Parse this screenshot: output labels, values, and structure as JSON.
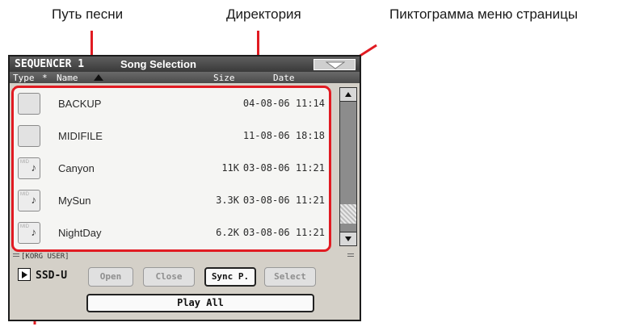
{
  "callouts": {
    "song_path": "Путь песни",
    "directory": "Директория",
    "page_menu_icon": "Пиктограмма меню страницы"
  },
  "window": {
    "title": "SEQUENCER 1",
    "subtitle": "Song Selection"
  },
  "columns": {
    "type": "Type",
    "star": "*",
    "name": "Name",
    "size": "Size",
    "date": "Date"
  },
  "files": [
    {
      "kind": "folder-icon",
      "name": "BACKUP",
      "size": "",
      "date": "04-08-06 11:14"
    },
    {
      "kind": "folder-icon",
      "name": "MIDIFILE",
      "size": "",
      "date": "11-08-06 18:18"
    },
    {
      "kind": "song-file-icon",
      "name": "Canyon",
      "size": "11K",
      "date": "03-08-06 11:21"
    },
    {
      "kind": "song-file-icon",
      "name": "MySun",
      "size": "3.3K",
      "date": "03-08-06 11:21"
    },
    {
      "kind": "song-file-icon",
      "name": "NightDay",
      "size": "6.2K",
      "date": "03-08-06 11:21"
    }
  ],
  "path_text": "[KORG USER]",
  "device": "SSD-U",
  "buttons": {
    "open": "Open",
    "close": "Close",
    "sync": "Sync P.",
    "select": "Select",
    "play_all": "Play All"
  },
  "colors": {
    "accent": "#e11b22",
    "titlebar": "#4a4a4a",
    "panel": "#d4d0c8"
  }
}
